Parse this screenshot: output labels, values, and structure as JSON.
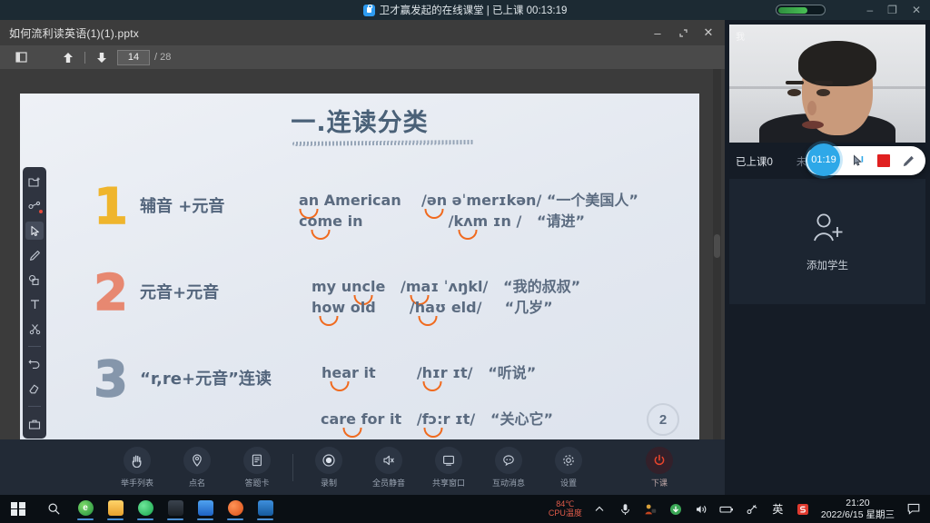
{
  "system_topbar": {
    "lock_icon": "lock-icon",
    "title": "卫才赢发起的在线课堂 | 已上课 00:13:19",
    "signal_icon": "signal-strength-indicator",
    "signal_percent": 65,
    "minimize": "–",
    "restore": "❐",
    "close": "✕"
  },
  "ppt_window": {
    "filename": "如何流利读英语(1)(1).pptx",
    "minimize": "–",
    "restore": "⌐",
    "close": "✕",
    "toolbar": {
      "sidebar_toggle_icon": "sidebar-panel-icon",
      "prev_icon": "arrow-up-icon",
      "next_icon": "arrow-down-icon",
      "page_current": "14",
      "page_total": "/ 28"
    }
  },
  "tool_rail": {
    "items": [
      {
        "name": "new-folder-icon",
        "glyph": "folder-plus"
      },
      {
        "name": "share-node-icon",
        "glyph": "share",
        "badge": true
      },
      {
        "name": "cursor-select-icon",
        "glyph": "cursor",
        "selected": true
      },
      {
        "name": "pen-icon",
        "glyph": "pen"
      },
      {
        "name": "shapes-icon",
        "glyph": "shapes"
      },
      {
        "name": "text-tool-icon",
        "glyph": "T"
      },
      {
        "name": "scissors-icon",
        "glyph": "scissors"
      },
      {
        "name": "undo-icon",
        "glyph": "undo"
      },
      {
        "name": "eraser-icon",
        "glyph": "eraser"
      },
      {
        "name": "toolbox-icon",
        "glyph": "toolbox"
      }
    ]
  },
  "slide": {
    "title": "一.连读分类",
    "page_badge": "2",
    "rows": [
      {
        "number": "1",
        "number_color": "#f0b323",
        "category": "辅音 +元音",
        "examples": [
          {
            "word_a": "an",
            "word_b": "American",
            "phonetic_a": "/ən",
            "phonetic_b": "əˈmerɪkən/",
            "meaning": "“一个美国人”"
          },
          {
            "word_a": "come",
            "word_b": "in",
            "phonetic_a": "/kʌm",
            "phonetic_b": "ɪn /",
            "meaning": "“请进”"
          }
        ]
      },
      {
        "number": "2",
        "number_color": "#e8836b",
        "category": "元音+元音",
        "examples": [
          {
            "word_a": "my",
            "word_b": "uncle",
            "phonetic_a": "/maɪ",
            "phonetic_b": "ˈʌŋkl/",
            "meaning": "“我的叔叔”"
          },
          {
            "word_a": "how",
            "word_b": "old",
            "phonetic_a": "/haʊ",
            "phonetic_b": "eld/",
            "meaning": "“几岁”"
          }
        ]
      },
      {
        "number": "3",
        "number_color": "#8092a8",
        "category": "“r,re+元音”连读",
        "examples": [
          {
            "word_a": "hear",
            "word_b": "it",
            "phonetic_a": "/hɪr",
            "phonetic_b": "ɪt/",
            "meaning": "“听说”"
          },
          {
            "word_a": "care for",
            "word_b": "it",
            "phonetic_a": "/fɔ:r",
            "phonetic_b": "ɪt/",
            "meaning": "“关心它”"
          }
        ]
      }
    ]
  },
  "control_bar": {
    "group_left": [
      {
        "icon": "raise-hand-icon",
        "label": "举手列表"
      },
      {
        "icon": "roll-call-icon",
        "label": "点名"
      },
      {
        "icon": "answer-card-icon",
        "label": "答题卡"
      }
    ],
    "group_right": [
      {
        "icon": "record-icon",
        "label": "录制"
      },
      {
        "icon": "mute-all-icon",
        "label": "全员静音"
      },
      {
        "icon": "share-window-icon",
        "label": "共享窗口"
      },
      {
        "icon": "chat-message-icon",
        "label": "互动消息"
      },
      {
        "icon": "settings-gear-icon",
        "label": "设置"
      }
    ],
    "end_class": {
      "icon": "power-icon",
      "label": "下课"
    }
  },
  "right_panel": {
    "camera": {
      "self_label": "我"
    },
    "float_toolbar": {
      "timer": "01:19",
      "cursor_icon": "cursor-pointer-icon",
      "stop_icon": "stop-record-icon",
      "pen_icon": "pen-icon"
    },
    "roster_tabs": [
      {
        "label": "已上课0",
        "active": true
      },
      {
        "label": "未上课0",
        "active": false
      }
    ],
    "roster_actions": [
      {
        "icon": "search-icon"
      },
      {
        "icon": "add-user-icon"
      }
    ],
    "empty_state": {
      "icon": "add-student-icon",
      "label": "添加学生"
    }
  },
  "taskbar": {
    "start_icon": "windows-start-icon",
    "search_icon": "taskbar-search-icon",
    "apps": [
      {
        "name": "edge-browser-icon",
        "color": "#2aa84a",
        "glyph": "e"
      },
      {
        "name": "file-explorer-icon",
        "color": "#f4b63f",
        "glyph": ""
      },
      {
        "name": "wechat-icon",
        "color": "#2bbd5c",
        "glyph": ""
      },
      {
        "name": "dark-app-icon",
        "color": "#2a3038",
        "glyph": ""
      },
      {
        "name": "classroom-app-icon",
        "color": "#2b7de0",
        "glyph": ""
      },
      {
        "name": "orange-app-icon",
        "color": "#e4602a",
        "glyph": ""
      },
      {
        "name": "media-player-icon",
        "color": "#1f6fc4",
        "glyph": ""
      }
    ],
    "tray": {
      "cpu_temp_value": "84℃",
      "cpu_temp_label": "CPU温度",
      "chevron_icon": "chevron-up-icon",
      "mic_icon": "microphone-icon",
      "security_icon": "security-icon",
      "update_icon": "update-icon",
      "volume_icon": "volume-icon",
      "battery_icon": "battery-icon",
      "network_icon": "network-icon",
      "ime_label": "英",
      "sogou_icon": "sogou-icon",
      "time": "21:20",
      "date": "2022/6/15 星期三",
      "action_center_icon": "action-center-icon"
    }
  }
}
